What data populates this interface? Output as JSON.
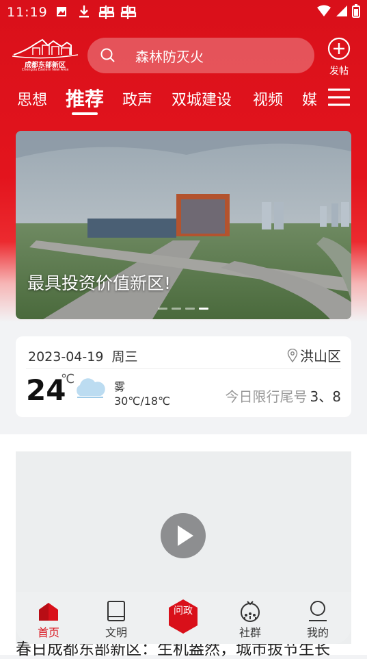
{
  "status_bar": {
    "time": "11:19",
    "icons": [
      "photo-icon",
      "download-icon",
      "bug-icon",
      "bug-icon",
      "wifi-icon",
      "signal-icon",
      "battery-icon"
    ]
  },
  "header": {
    "logo_text": "成都东部新区",
    "logo_subtext": "Chengdu Eastern New Area",
    "search_text": "森林防灭火",
    "post_label": "发帖"
  },
  "tabs": [
    {
      "label": "思想"
    },
    {
      "label": "推荐"
    },
    {
      "label": "政声"
    },
    {
      "label": "双城建设"
    },
    {
      "label": "视频"
    },
    {
      "label": "媒"
    }
  ],
  "banner": {
    "title": "最具投资价值新区!",
    "page_index": 4,
    "page_count": 4
  },
  "weather": {
    "date": "2023-04-19",
    "weekday": "周三",
    "location": "洪山区",
    "temperature": "24",
    "unit": "℃",
    "condition": "雾",
    "range": "30℃/18℃",
    "limit_label": "今日限行尾号",
    "limit_numbers": "3、8"
  },
  "article": {
    "title": "春日成都东部新区：生机盎然，城市拔节生长"
  },
  "bottom_nav": {
    "items": [
      {
        "label": "首页"
      },
      {
        "label": "文明"
      },
      {
        "label": "问政"
      },
      {
        "label": "社群"
      },
      {
        "label": "我的"
      }
    ]
  },
  "colors": {
    "brand_red": "#d9101a",
    "text": "#333333",
    "muted": "#999999"
  }
}
